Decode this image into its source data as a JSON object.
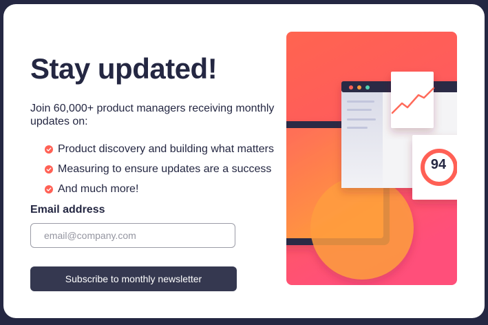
{
  "signup": {
    "title": "Stay updated!",
    "intro": "Join 60,000+ product managers receiving monthly updates on:",
    "features": [
      "Product discovery and building what matters",
      "Measuring to ensure updates are a success",
      "And much more!"
    ],
    "email_label": "Email address",
    "email_placeholder": "email@company.com",
    "email_value": "",
    "submit_label": "Subscribe to monthly newsletter"
  },
  "illustration": {
    "score": "94"
  },
  "colors": {
    "dark": "#242742",
    "tomato": "#ff6155",
    "button": "#353850"
  },
  "icons": {
    "feature_bullet": "check-circle-icon"
  }
}
